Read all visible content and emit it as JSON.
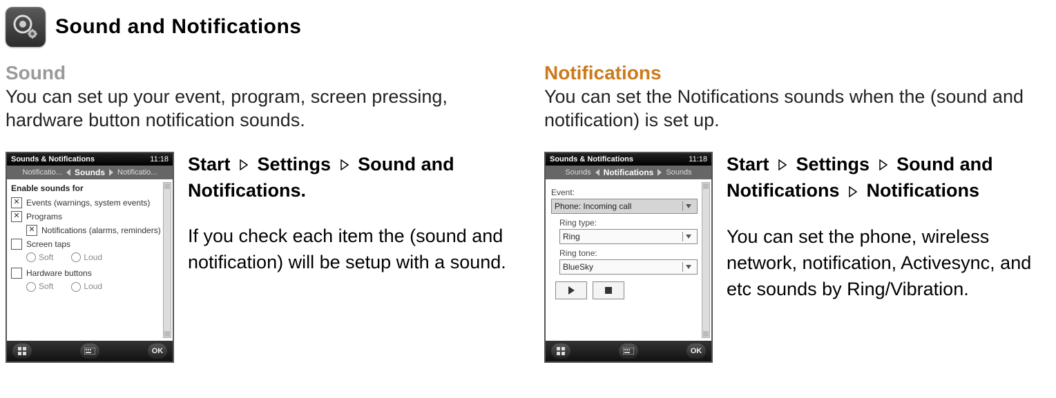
{
  "page": {
    "title": "Sound and Notifications"
  },
  "left": {
    "heading": "Sound",
    "intro": "You can set up your event, program, screen pressing, hardware button notification sounds.",
    "path": {
      "p1": "Start",
      "p2": "Settings",
      "p3": "Sound and Notifications."
    },
    "body": "If you check each item the (sound and notification) will be setup with a sound.",
    "phone": {
      "status_title": "Sounds & Notifications",
      "status_time": "11:18",
      "nav_left": "Notificatio...",
      "nav_center": "Sounds",
      "nav_right": "Notificatio...",
      "group_title": "Enable sounds for",
      "row1": "Events (warnings, system events)",
      "row2": "Programs",
      "row3": "Notifications (alarms, reminders)",
      "row4": "Screen taps",
      "row5": "Hardware buttons",
      "soft": "Soft",
      "loud": "Loud",
      "ok": "OK"
    }
  },
  "right": {
    "heading": "Notifications",
    "intro": "You can set the Notifications sounds when the (sound and notification) is set up.",
    "path": {
      "p1": "Start",
      "p2": "Settings",
      "p3": "Sound and Notifications",
      "p4": "Notifications"
    },
    "body": "You can set the phone, wireless network, notification, Activesync, and etc sounds by Ring/Vibration.",
    "phone": {
      "status_title": "Sounds & Notifications",
      "status_time": "11:18",
      "nav_left": "Sounds",
      "nav_center": "Notifications",
      "nav_right": "Sounds",
      "event_label": "Event:",
      "event_value": "Phone: Incoming call",
      "ringtype_label": "Ring type:",
      "ringtype_value": "Ring",
      "ringtone_label": "Ring tone:",
      "ringtone_value": "BlueSky",
      "ok": "OK"
    }
  }
}
